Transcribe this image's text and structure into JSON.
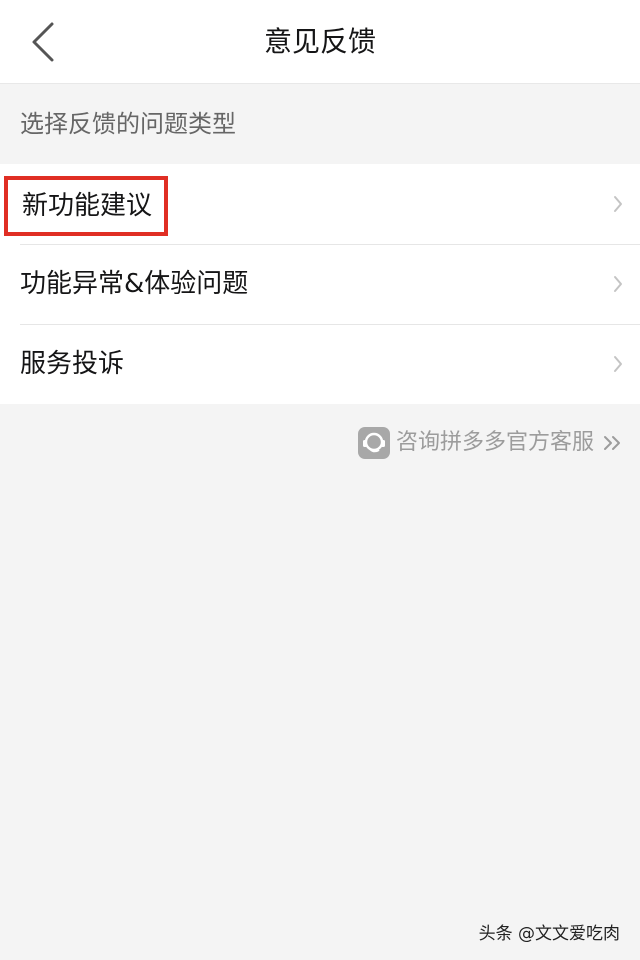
{
  "header": {
    "back_icon": "chevron-left-icon",
    "title": "意见反馈"
  },
  "section": {
    "label": "选择反馈的问题类型"
  },
  "feedback_types": [
    {
      "label": "新功能建议",
      "highlighted": true,
      "highlight_color": "#e02e24",
      "icon": "chevron-right-icon"
    },
    {
      "label": "功能异常&体验问题",
      "highlighted": false,
      "icon": "chevron-right-icon"
    },
    {
      "label": "服务投诉",
      "highlighted": false,
      "icon": "chevron-right-icon"
    }
  ],
  "customer_service": {
    "icon": "customer-service-icon",
    "label": "咨询拼多多官方客服",
    "trailing_icon": "double-chevron-right-icon"
  },
  "watermark": {
    "text": "头条 @文文爱吃肉"
  },
  "colors": {
    "background": "#f4f4f4",
    "surface": "#ffffff",
    "highlight": "#e02e24",
    "muted_text": "#9c9c9c"
  }
}
